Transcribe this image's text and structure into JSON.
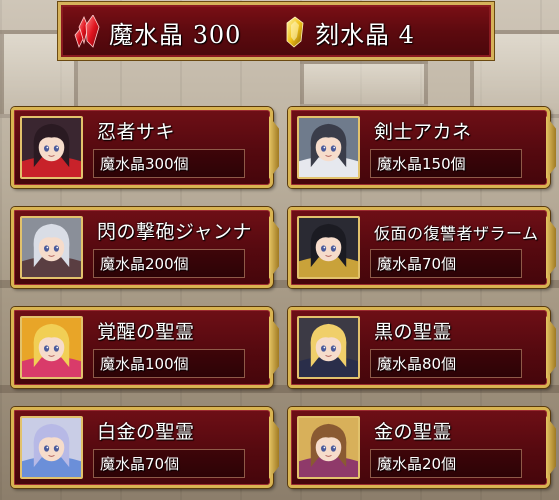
{
  "currency": {
    "magic_crystal_label": "魔水晶 300",
    "time_crystal_label": "刻水晶 4",
    "magic_crystal_icon": "red-crystal-icon",
    "time_crystal_icon": "gold-crystal-icon"
  },
  "cards": [
    {
      "name": "忍者サキ",
      "price": "魔水晶300個",
      "portrait": "ninja-saki-portrait",
      "hair": "#2a1a22",
      "outfit": "#c8222a",
      "bg": "#3a2630"
    },
    {
      "name": "剣士アカネ",
      "price": "魔水晶150個",
      "portrait": "swordsman-akane-portrait",
      "hair": "#3a3d4a",
      "outfit": "#e6e8ee",
      "bg": "#6f7b8c"
    },
    {
      "name": "閃の撃砲ジャンナ",
      "price": "魔水晶200個",
      "portrait": "gunner-janna-portrait",
      "hair": "#d9dde6",
      "outfit": "#5a3e42",
      "bg": "#8a8f99"
    },
    {
      "name": "仮面の復讐者ザラーム",
      "price": "魔水晶70個",
      "portrait": "masked-avenger-zalam-portrait",
      "hair": "#1b1b22",
      "outfit": "#c9a23a",
      "bg": "#2a2a33"
    },
    {
      "name": "覚醒の聖霊",
      "price": "魔水晶100個",
      "portrait": "awakened-spirit-portrait",
      "hair": "#f1cf55",
      "outfit": "#d93b6a",
      "bg": "#e8a528"
    },
    {
      "name": "黒の聖霊",
      "price": "魔水晶80個",
      "portrait": "black-spirit-portrait",
      "hair": "#f0cf6a",
      "outfit": "#2a2e4a",
      "bg": "#3c3a45"
    },
    {
      "name": "白金の聖霊",
      "price": "魔水晶70個",
      "portrait": "platinum-spirit-portrait",
      "hair": "#b7b9e6",
      "outfit": "#6b8fd9",
      "bg": "#c9cde6"
    },
    {
      "name": "金の聖霊",
      "price": "魔水晶20個",
      "portrait": "gold-spirit-portrait",
      "hair": "#8a5a32",
      "outfit": "#8f3a6a",
      "bg": "#d8b05a"
    }
  ]
}
